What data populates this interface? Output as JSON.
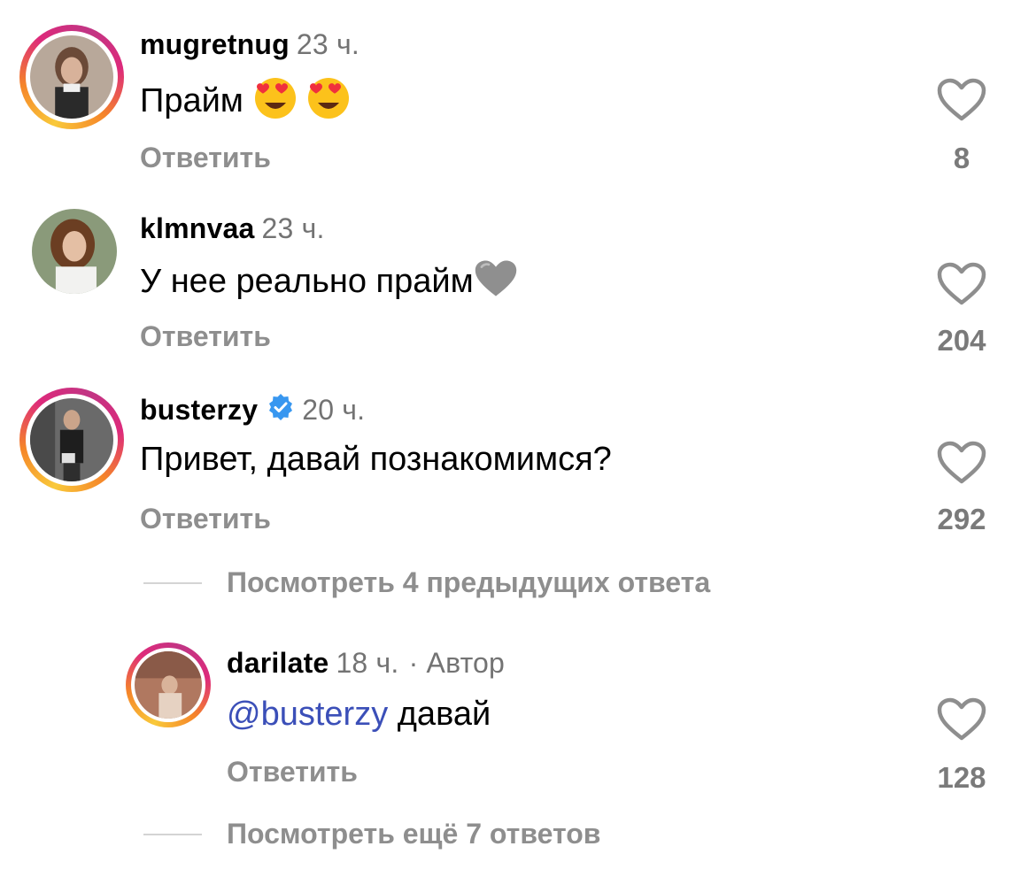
{
  "comments": [
    {
      "username": "mugretnug",
      "time": "23 ч.",
      "text": "Прайм",
      "emoji": [
        "heart-eyes-emoji",
        "heart-eyes-emoji"
      ],
      "reply_label": "Ответить",
      "likes": "8"
    },
    {
      "username": "klmnvaa",
      "time": "23 ч.",
      "text": "У нее реально прайм",
      "emoji": [
        "grey-heart-emoji"
      ],
      "reply_label": "Ответить",
      "likes": "204"
    },
    {
      "username": "busterzy",
      "verified": true,
      "time": "20 ч.",
      "text": "Привет, давай познакомимся?",
      "reply_label": "Ответить",
      "likes": "292",
      "view_previous": "Посмотреть 4 предыдущих ответа",
      "replies": [
        {
          "username": "darilate",
          "time": "18 ч.",
          "author_tag": "· Автор",
          "mention": "@busterzy",
          "text": " давай",
          "reply_label": "Ответить",
          "likes": "128"
        }
      ],
      "view_more": "Посмотреть ещё 7 ответов"
    }
  ],
  "colors": {
    "mention": "#3b4fb8",
    "secondary_text": "#8e8e8e",
    "verified": "#3897f0"
  }
}
